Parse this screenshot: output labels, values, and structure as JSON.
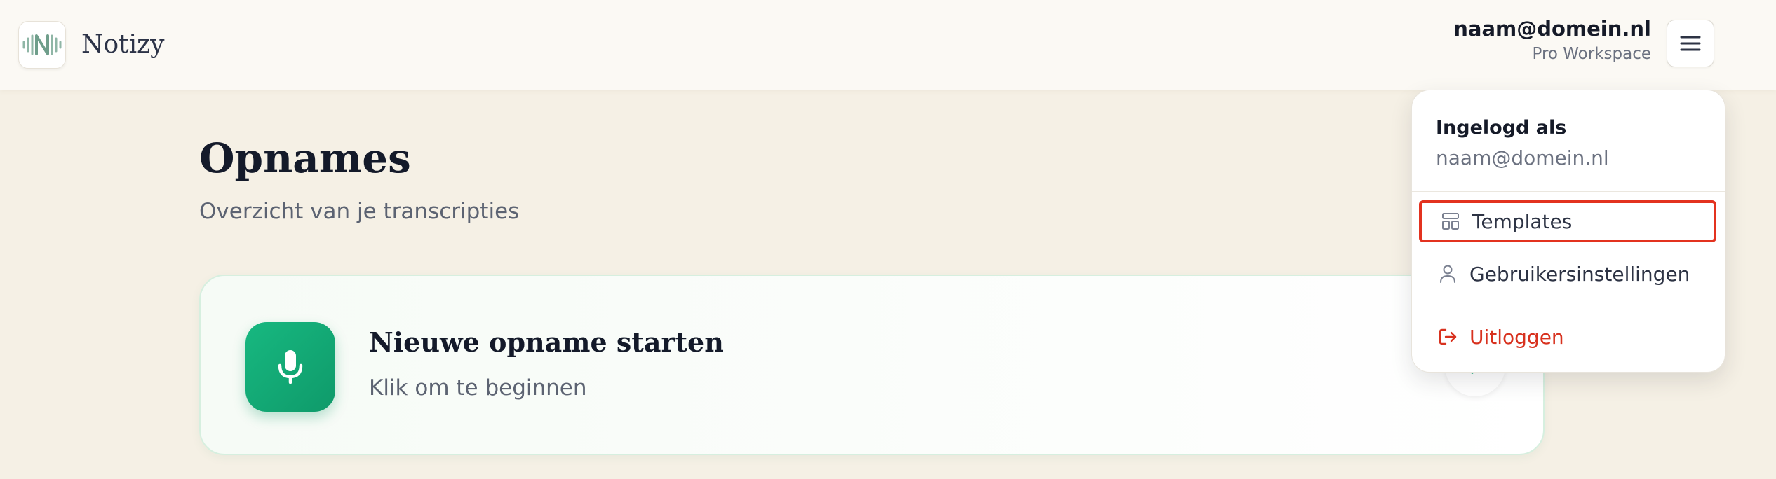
{
  "app": {
    "name": "Notizy"
  },
  "header": {
    "user_email": "naam@domein.nl",
    "user_plan": "Pro Workspace"
  },
  "main": {
    "title": "Opnames",
    "subtitle": "Overzicht van je transcripties",
    "record_card": {
      "title": "Nieuwe opname starten",
      "subtitle": "Klik om te beginnen"
    }
  },
  "dropdown": {
    "logged_in_label": "Ingelogd als",
    "logged_in_email": "naam@domein.nl",
    "items": [
      {
        "label": "Templates",
        "icon": "layout-template-icon"
      },
      {
        "label": "Gebruikersinstellingen",
        "icon": "user-icon"
      }
    ],
    "logout_label": "Uitloggen",
    "logout_icon": "logout-icon"
  },
  "colors": {
    "accent_green": "#12a876",
    "danger_red": "#d8321f",
    "highlight_red": "#e3321f",
    "background": "#f5f0e5"
  }
}
